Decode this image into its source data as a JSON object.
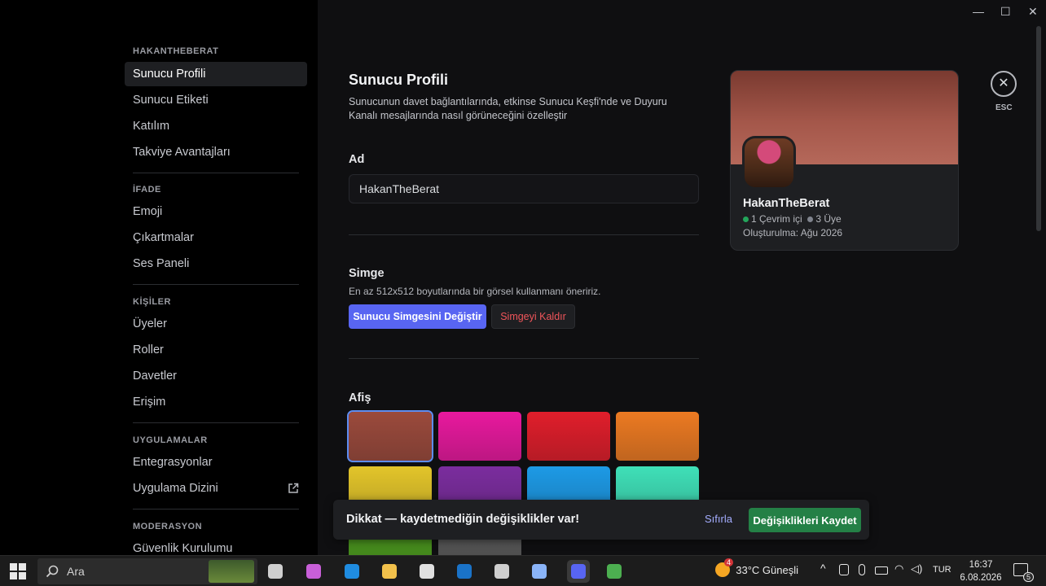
{
  "window": {
    "minimize_glyph": "—",
    "maximize_glyph": "☐",
    "close_glyph": "✕"
  },
  "sidebar": {
    "sections": [
      {
        "title": "HAKANTHEBERAT",
        "items": [
          "Sunucu Profili",
          "Sunucu Etiketi",
          "Katılım",
          "Takviye Avantajları"
        ]
      },
      {
        "title": "İFADE",
        "items": [
          "Emoji",
          "Çıkartmalar",
          "Ses Paneli"
        ]
      },
      {
        "title": "KİŞİLER",
        "items": [
          "Üyeler",
          "Roller",
          "Davetler",
          "Erişim"
        ]
      },
      {
        "title": "UYGULAMALAR",
        "items": [
          "Entegrasyonlar",
          "Uygulama Dizini"
        ]
      },
      {
        "title": "MODERASYON",
        "items": [
          "Güvenlik Kurulumu"
        ]
      }
    ],
    "active_item": "Sunucu Profili"
  },
  "main": {
    "title": "Sunucu Profili",
    "subtitle": "Sunucunun davet bağlantılarında, etkinse Sunucu Keşfi'nde ve Duyuru Kanalı mesajlarında nasıl görüneceğini özelleştir",
    "name_label": "Ad",
    "name_value": "HakanTheBerat",
    "icon_label": "Simge",
    "icon_hint": "En az 512x512 boyutlarında bir görsel kullanmanı öneririz.",
    "change_icon_button": "Sunucu Simgesini Değiştir",
    "remove_icon_button": "Simgeyi Kaldır",
    "banner_label": "Afiş",
    "banner_colors": [
      "#9b4a3c",
      "#e8199e",
      "#e01e2b",
      "#ec7a22",
      "#e3c52a",
      "#7b2d9e",
      "#1d9ae6",
      "#3fe0b8",
      "#4c9a1e",
      "#5a5a5a"
    ],
    "selected_banner_index": 0
  },
  "preview_card": {
    "server_name": "HakanTheBerat",
    "online": "1 Çevrim içi",
    "members": "3 Üye",
    "created": "Oluşturulma: Ağu 2026",
    "online_color": "#23a55a",
    "members_color": "#80848e"
  },
  "close": {
    "glyph": "✕",
    "label": "ESC"
  },
  "notice_bar": {
    "message": "Dikkat — kaydetmediğin değişiklikler var!",
    "reset": "Sıfırla",
    "save": "Değişiklikleri Kaydet"
  },
  "taskbar": {
    "search_placeholder": "Ara",
    "weather_temp": "33°C",
    "weather_text": "Güneşli",
    "weather_alert": "4",
    "language": "TUR",
    "time": "16:37",
    "date": "6.08.2026",
    "notification_count": "5",
    "apps": [
      "task-view-icon",
      "copilot-icon",
      "edge-icon",
      "file-explorer-icon",
      "microsoft-store-icon",
      "outlook-icon",
      "clock-app-icon",
      "photos-icon",
      "discord-icon",
      "minecraft-icon"
    ]
  }
}
